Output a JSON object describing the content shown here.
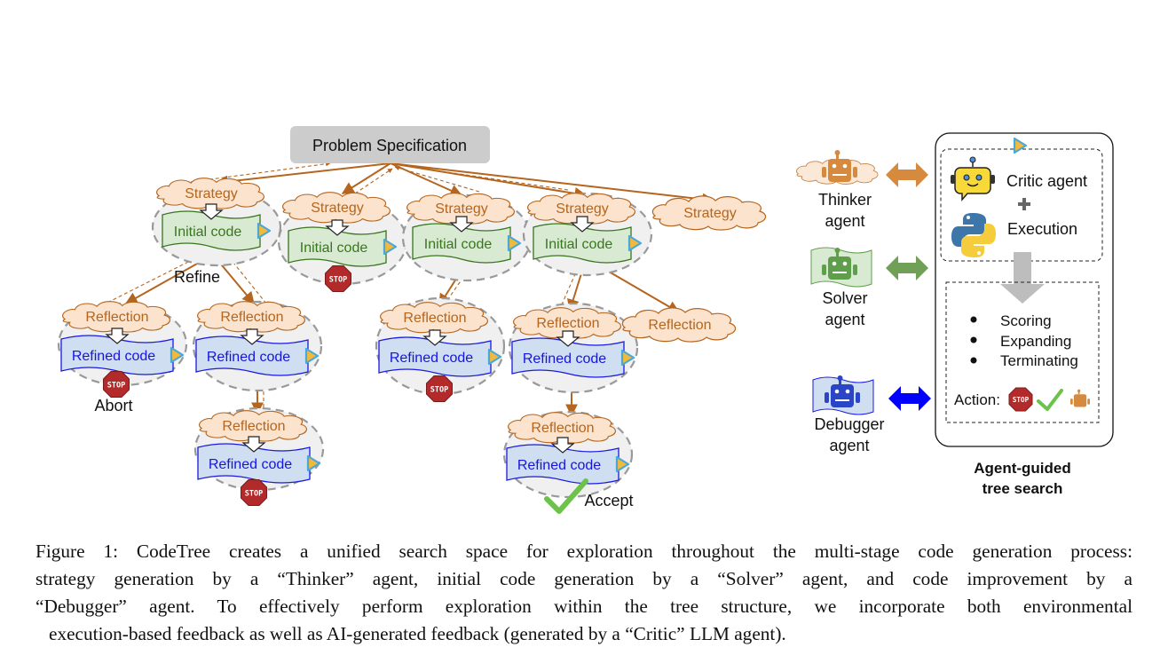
{
  "figure": {
    "problem_spec": "Problem Specification",
    "strategy_label": "Strategy",
    "initial_code_label": "Initial code",
    "reflection_label": "Reflection",
    "refined_code_label": "Refined code",
    "refine_label": "Refine",
    "abort_label": "Abort",
    "accept_label": "Accept",
    "stop_label": "STOP"
  },
  "agents": {
    "thinker": {
      "line1": "Thinker",
      "line2": "agent",
      "color": "#d68a3e"
    },
    "solver": {
      "line1": "Solver",
      "line2": "agent",
      "color": "#5f9e4a"
    },
    "debugger": {
      "line1": "Debugger",
      "line2": "agent",
      "color": "#0000ff"
    }
  },
  "panel": {
    "critic": "Critic agent",
    "plus": "+",
    "execution": "Execution",
    "bullets": [
      "Scoring",
      "Expanding",
      "Terminating"
    ],
    "action_label": "Action:",
    "title_line1": "Agent-guided",
    "title_line2": "tree search"
  },
  "colors": {
    "edge": "#b5651d",
    "strategy_fill": "#fbe3cd",
    "strategy_text": "#b5651d",
    "initial_fill": "#d9ead3",
    "initial_stroke": "#38761d",
    "initial_text": "#38761d",
    "refined_fill": "#d0def2",
    "refined_stroke": "#1a1adf",
    "refined_text": "#1515e0",
    "stop": "#b22a2a",
    "check": "#6cc24a",
    "play_fill": "#f3b93a",
    "play_stroke": "#4aa8d8"
  },
  "caption": {
    "lines": [
      "Figure 1: CodeTree creates a unified search space for exploration throughout the multi-stage code generation process:",
      "strategy generation by a “Thinker” agent, initial code generation by a “Solver” agent, and code improvement by a",
      "“Debugger” agent. To effectively perform exploration within the tree structure, we incorporate both environmental",
      "execution-based feedback as well as AI-generated feedback (generated by a “Critic” LLM agent)."
    ]
  }
}
